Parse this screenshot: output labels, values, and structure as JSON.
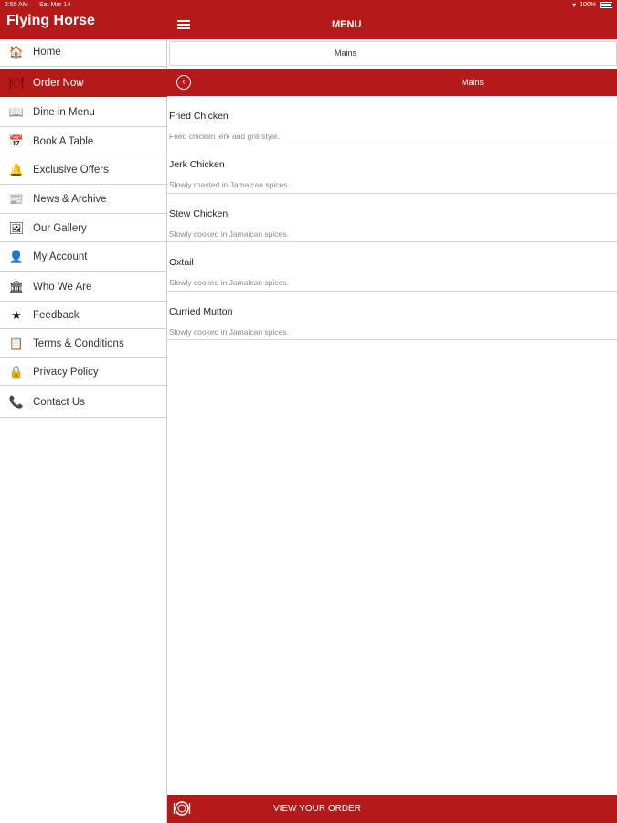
{
  "status": {
    "time": "2:55 AM",
    "date": "Sat Mar 14",
    "battery": "100%"
  },
  "app": {
    "title": "Flying Horse"
  },
  "sidebar": {
    "items": [
      {
        "label": "Home",
        "icon": "home-icon",
        "glyph": "🏠"
      },
      {
        "label": "Order Now",
        "icon": "dish-icon",
        "glyph": "🍽"
      },
      {
        "label": "Dine in Menu",
        "icon": "menu-book-icon",
        "glyph": "📖"
      },
      {
        "label": "Book A Table",
        "icon": "calendar-icon",
        "glyph": "📅"
      },
      {
        "label": "Exclusive Offers",
        "icon": "bell-icon",
        "glyph": "🔔"
      },
      {
        "label": "News & Archive",
        "icon": "news-icon",
        "glyph": "📰"
      },
      {
        "label": "Our Gallery",
        "icon": "gallery-icon",
        "glyph": "🖼"
      },
      {
        "label": "My Account",
        "icon": "user-icon",
        "glyph": "👤"
      },
      {
        "label": "Who We Are",
        "icon": "info-icon",
        "glyph": "🏛"
      },
      {
        "label": "Feedback",
        "icon": "star-icon",
        "glyph": "★"
      },
      {
        "label": "Terms & Conditions",
        "icon": "document-icon",
        "glyph": "📋"
      },
      {
        "label": "Privacy Policy",
        "icon": "lock-icon",
        "glyph": "🔒"
      },
      {
        "label": "Contact Us",
        "icon": "phone-icon",
        "glyph": "📞"
      }
    ],
    "active_index": 1
  },
  "header": {
    "title": "MENU"
  },
  "subtab": {
    "label": "Mains"
  },
  "category": {
    "label": "Mains"
  },
  "menu_items": [
    {
      "name": "Fried Chicken",
      "description": "Fried chicken jerk and grill style."
    },
    {
      "name": "Jerk Chicken",
      "description": "Slowly roasted in Jamaican spices."
    },
    {
      "name": "Stew Chicken",
      "description": "Slowly cooked in Jamaican spices."
    },
    {
      "name": "Oxtail",
      "description": "Slowly cooked in Jamaican spices."
    },
    {
      "name": "Curried Mutton",
      "description": "Slowly cooked in Jamaican spices."
    }
  ],
  "footer": {
    "view_order_label": "VIEW YOUR ORDER"
  },
  "colors": {
    "accent": "#b5191a",
    "divider": "#cfcfcf"
  }
}
